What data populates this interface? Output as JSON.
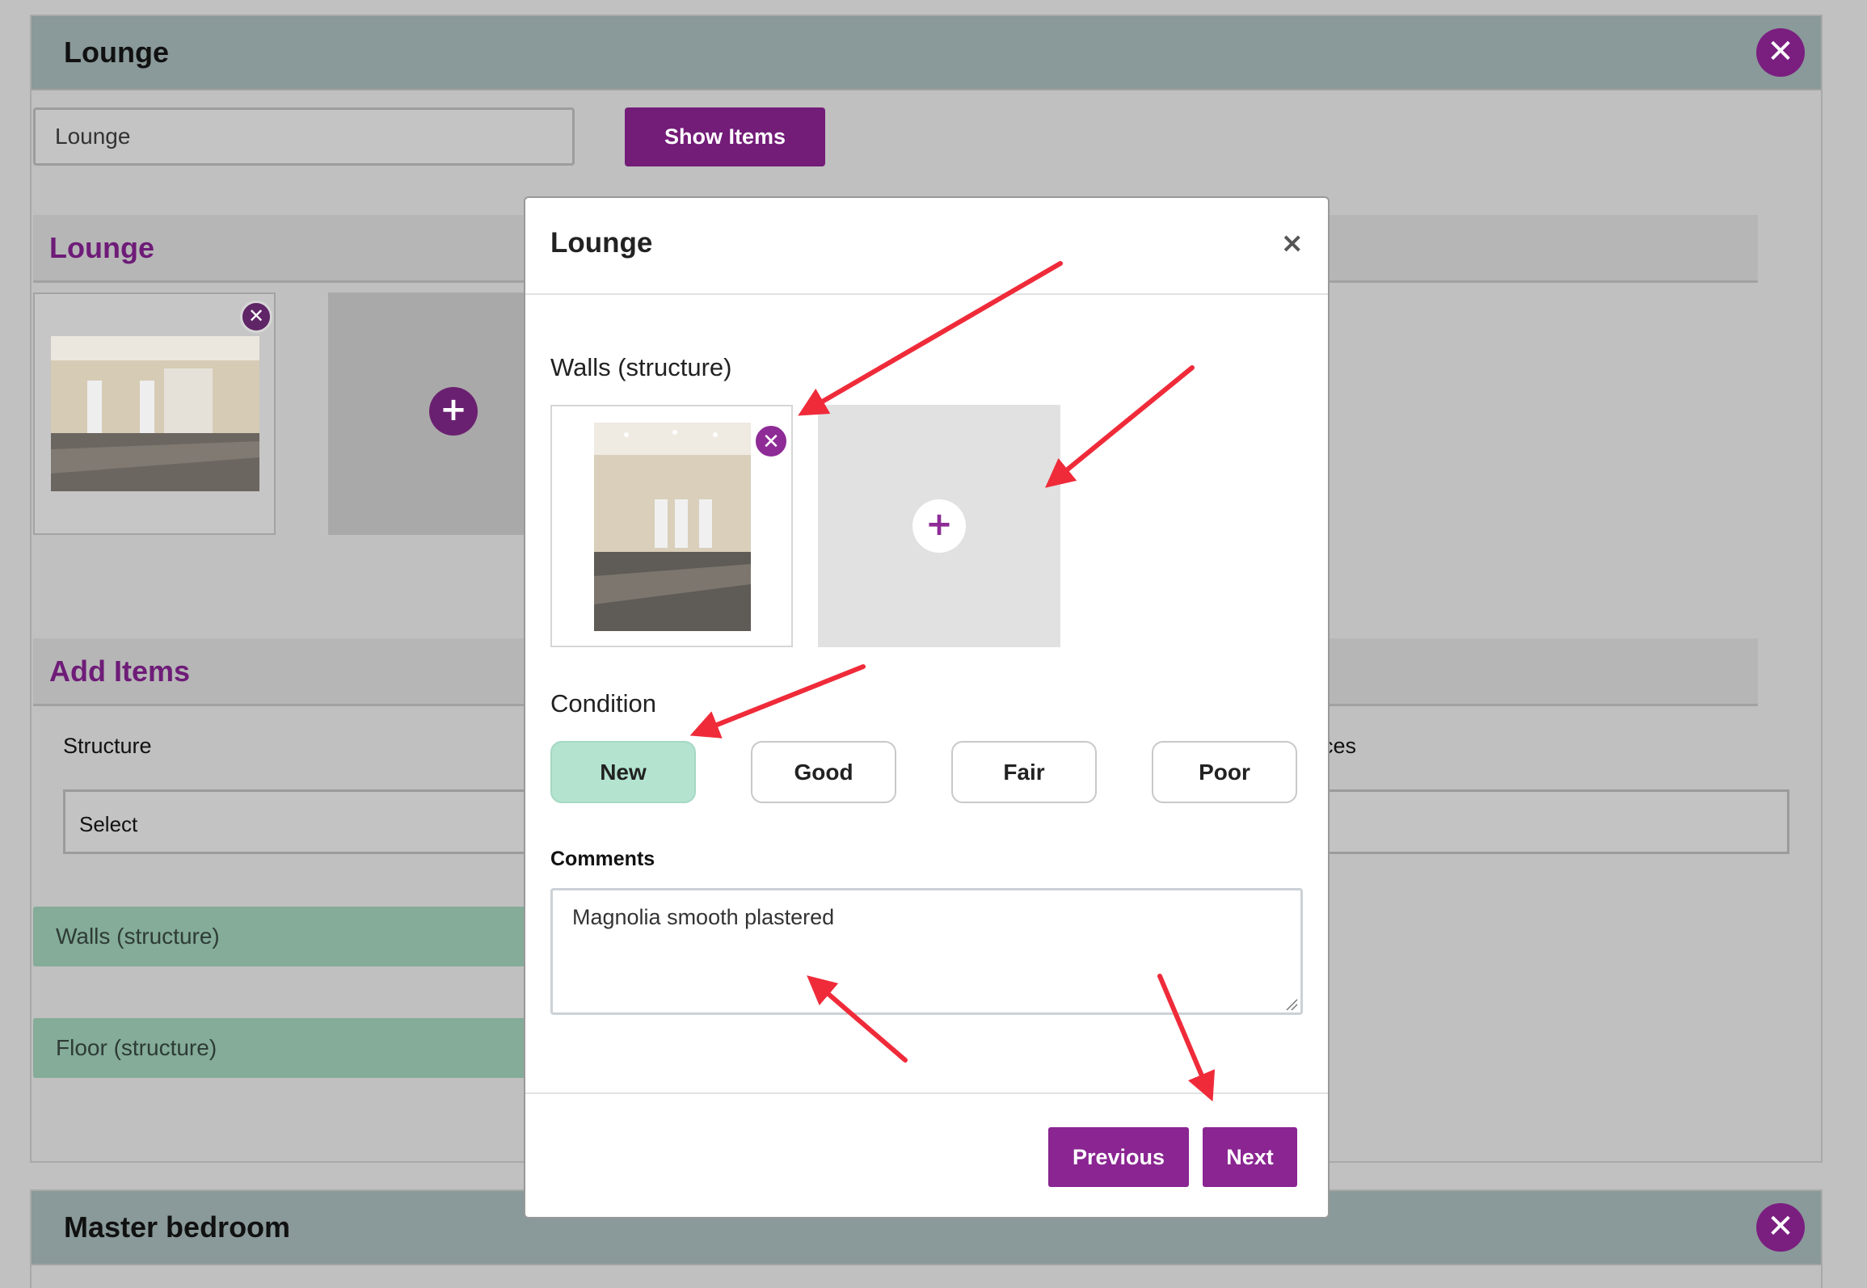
{
  "rooms": [
    {
      "name": "Lounge"
    },
    {
      "name": "Master bedroom"
    }
  ],
  "room_panel": {
    "name_input_value": "Lounge",
    "show_items_label": "Show Items",
    "section_title": "Lounge",
    "add_items_title": "Add Items",
    "category_left_label": "Structure",
    "category_right_label_partial": "ces",
    "select_value": "Select",
    "items": [
      "Walls (structure)",
      "Floor (structure)"
    ]
  },
  "modal": {
    "title": "Lounge",
    "close_glyph": "×",
    "item_title": "Walls (structure)",
    "condition_label": "Condition",
    "conditions": [
      "New",
      "Good",
      "Fair",
      "Poor"
    ],
    "selected_condition": "New",
    "comments_label": "Comments",
    "comments_value": "Magnolia smooth plastered",
    "previous_label": "Previous",
    "next_label": "Next"
  },
  "icons": {
    "close": "close-icon",
    "add": "plus-icon",
    "dropdown": "chevron-down-icon"
  },
  "colors": {
    "brand_purple": "#8a2592",
    "selected_condition": "#b4e4d0",
    "item_pill": "#84ac98",
    "annotation_arrow": "#ef2b3a"
  }
}
